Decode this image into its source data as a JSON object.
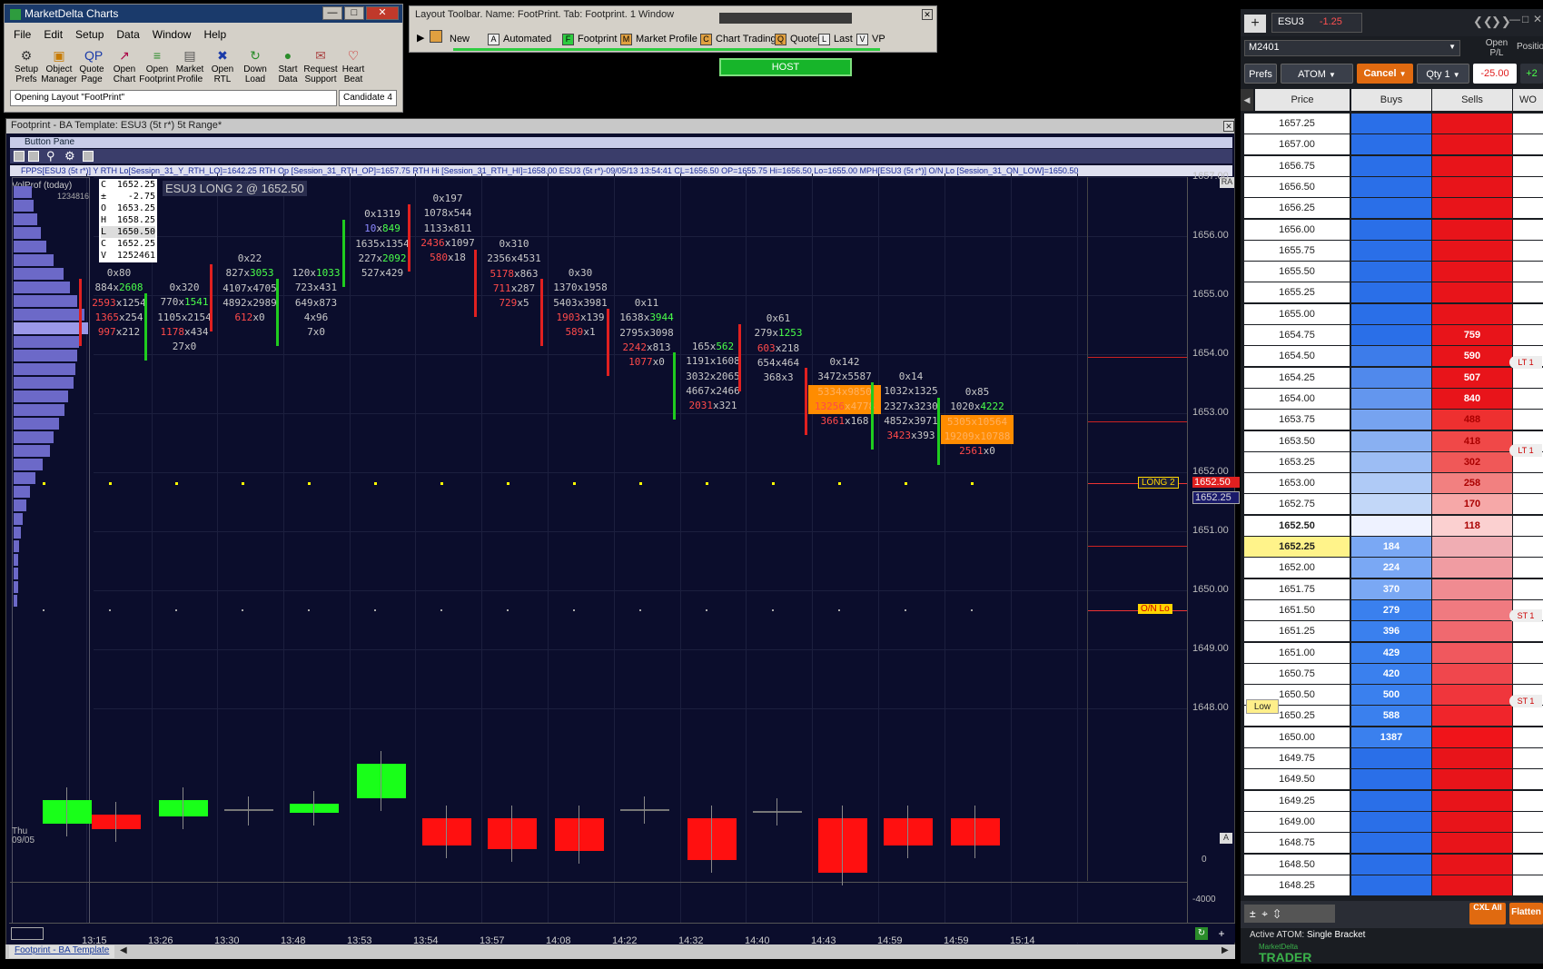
{
  "launcher": {
    "title": "MarketDelta Charts",
    "menu": [
      "File",
      "Edit",
      "Setup",
      "Data",
      "Window",
      "Help"
    ],
    "tools": [
      {
        "l1": "Setup",
        "l2": "Prefs",
        "icon": "gear-icon"
      },
      {
        "l1": "Object",
        "l2": "Manager",
        "icon": "object-manager-icon"
      },
      {
        "l1": "Quote",
        "l2": "Page",
        "icon": "quote-page-icon"
      },
      {
        "l1": "Open",
        "l2": "Chart",
        "icon": "chart-icon"
      },
      {
        "l1": "Open",
        "l2": "Footprint",
        "icon": "footprint-icon"
      },
      {
        "l1": "Market",
        "l2": "Profile",
        "icon": "market-profile-icon"
      },
      {
        "l1": "Open",
        "l2": "RTL",
        "icon": "rtl-icon"
      },
      {
        "l1": "Down",
        "l2": "Load",
        "icon": "download-icon"
      },
      {
        "l1": "Start",
        "l2": "Data",
        "icon": "start-data-icon"
      },
      {
        "l1": "Request",
        "l2": "Support",
        "icon": "support-icon"
      },
      {
        "l1": "Heart",
        "l2": "Beat",
        "icon": "heartbeat-icon"
      }
    ],
    "status": "Opening Layout \"FootPrint\"",
    "candidate": "Candidate 4"
  },
  "layout_toolbar": {
    "title": "Layout Toolbar.  Name: FootPrint.  Tab: Footprint.  1 Window",
    "items": [
      {
        "key": "",
        "label": "New"
      },
      {
        "key": "A",
        "label": "Automated"
      },
      {
        "key": "F",
        "label": "Footprint"
      },
      {
        "key": "M",
        "label": "Market Profile"
      },
      {
        "key": "C",
        "label": "Chart Trading"
      },
      {
        "key": "Q",
        "label": "Quotes"
      },
      {
        "key": "L",
        "label": "Last"
      },
      {
        "key": "V",
        "label": "VP"
      }
    ],
    "host": "HOST"
  },
  "chart": {
    "title": "Footprint - BA Template: ESU3 (5t r*) 5t Range*",
    "button_pane": "Button Pane",
    "study_line": "FPPS[ESU3 (5t r*)]  Y RTH Lo[Session_31_Y_RTH_LO]=1642.25  RTH Op [Session_31_RTH_OP]=1657.75  RTH Hi [Session_31_RTH_HI]=1658.00  ESU3 (5t r*)-09/05/13 13:54:41 CL=1656.50 OP=1655.75 Hi=1656.50 Lo=1655.00  MPH[ESU3 (5t r*)]  O/N Lo [Session_31_ON_LOW]=1650.50",
    "volprof": "VolProf (today)",
    "volprof_val": "1234816",
    "ra": "RA",
    "position": "ESU3 LONG 2 @ 1652.50",
    "ohlc": [
      [
        "C",
        "1652.25"
      ],
      [
        "±",
        "-2.75"
      ],
      [
        "O",
        "1653.25"
      ],
      [
        "H",
        "1658.25"
      ],
      [
        "L",
        "1650.50"
      ],
      [
        "C",
        "1652.25"
      ],
      [
        "V",
        "1252461"
      ]
    ],
    "price_axis": [
      "1657.00",
      "1656.00",
      "1655.00",
      "1654.00",
      "1653.00",
      "1652.00",
      "1651.00",
      "1650.00",
      "1649.00",
      "1648.00"
    ],
    "last_price": "1652.50",
    "bid_price": "1652.25",
    "long_tag": "LONG 2",
    "on_lo_tag": "O/N Lo",
    "lower_axis": [
      "0",
      "-4000"
    ],
    "time_labels": [
      "13:15",
      "13:26",
      "13:30",
      "13:48",
      "13:53",
      "13:54",
      "13:57",
      "14:08",
      "14:22",
      "14:32",
      "14:40",
      "14:43",
      "14:59",
      "14:59",
      "15:14"
    ],
    "day": "Thu",
    "date": "09/05",
    "tab": "Footprint - BA Template",
    "footprints": [
      [
        [
          "0x80",
          ""
        ],
        [
          "884",
          "2608"
        ],
        [
          "2593",
          "1254"
        ],
        [
          "1365",
          "254"
        ],
        [
          "997",
          "212"
        ]
      ],
      [
        [
          "0x320",
          ""
        ],
        [
          "770",
          "1541"
        ],
        [
          "1105",
          "2154"
        ],
        [
          "1178",
          "434"
        ],
        [
          "27",
          "0"
        ]
      ],
      [
        [
          "0x22",
          ""
        ],
        [
          "827",
          "3053"
        ],
        [
          "4107",
          "4705"
        ],
        [
          "4892",
          "2989"
        ],
        [
          "612",
          "0"
        ]
      ],
      [
        [
          "120",
          "1033"
        ],
        [
          "723",
          "431"
        ],
        [
          "649",
          "873"
        ],
        [
          "4",
          "96"
        ],
        [
          "7",
          "0"
        ]
      ],
      [
        [
          "0x1319",
          ""
        ],
        [
          "10",
          "849"
        ],
        [
          "1635",
          "1354"
        ],
        [
          "227",
          "2092"
        ],
        [
          "527",
          "429"
        ]
      ],
      [
        [
          "0x197",
          ""
        ],
        [
          "1078",
          "544"
        ],
        [
          "1133",
          "811"
        ],
        [
          "2436",
          "1097"
        ],
        [
          "580",
          "18"
        ]
      ],
      [
        [
          "0x310",
          ""
        ],
        [
          "2356",
          "4531"
        ],
        [
          "5178",
          "863"
        ],
        [
          "711",
          "287"
        ],
        [
          "729",
          "5"
        ]
      ],
      [
        [
          "0x30",
          ""
        ],
        [
          "1370",
          "1958"
        ],
        [
          "5403",
          "3981"
        ],
        [
          "1903",
          "139"
        ],
        [
          "589",
          "1"
        ]
      ],
      [
        [
          "0x11",
          ""
        ],
        [
          "1638",
          "3944"
        ],
        [
          "2795",
          "3098"
        ],
        [
          "2242",
          "813"
        ],
        [
          "1077",
          "0"
        ]
      ],
      [
        [
          "165",
          "562"
        ],
        [
          "1191",
          "1608"
        ],
        [
          "3032",
          "2065"
        ],
        [
          "4667",
          "2466"
        ],
        [
          "2031",
          "321"
        ]
      ],
      [
        [
          "0x61",
          ""
        ],
        [
          "279",
          "1253"
        ],
        [
          "603",
          "218"
        ],
        [
          "654",
          "464"
        ],
        [
          "368",
          "3"
        ]
      ],
      [
        [
          "0x142",
          ""
        ],
        [
          "3472",
          "5587"
        ],
        [
          "5334",
          "9850"
        ],
        [
          "13256",
          "4778"
        ],
        [
          "3661",
          "168"
        ]
      ],
      [
        [
          "0x14",
          ""
        ],
        [
          "1032",
          "1325"
        ],
        [
          "2327",
          "3230"
        ],
        [
          "4852",
          "3971"
        ],
        [
          "3423",
          "393"
        ]
      ],
      [
        [
          "0x85",
          ""
        ],
        [
          "1020",
          "4222"
        ],
        [
          "5305",
          "10564"
        ],
        [
          "19209",
          "10788"
        ],
        [
          "2561",
          "0"
        ]
      ]
    ]
  },
  "dom": {
    "symbol": "ESU3",
    "change": "-1.25",
    "account": "M2401",
    "open_pl_hdr": "Open P/L",
    "position_hdr": "Position",
    "prefs": "Prefs",
    "atom": "ATOM",
    "cancel": "Cancel",
    "qty": "Qty 1",
    "pl": "-25.00",
    "pos": "+2",
    "headers": {
      "price": "Price",
      "buys": "Buys",
      "sells": "Sells",
      "wo": "WO"
    },
    "rows": [
      {
        "p": "1657.25",
        "b": "",
        "s": ""
      },
      {
        "p": "1657.00",
        "b": "",
        "s": ""
      },
      {
        "p": "1656.75",
        "b": "",
        "s": ""
      },
      {
        "p": "1656.50",
        "b": "",
        "s": ""
      },
      {
        "p": "1656.25",
        "b": "",
        "s": ""
      },
      {
        "p": "1656.00",
        "b": "",
        "s": ""
      },
      {
        "p": "1655.75",
        "b": "",
        "s": ""
      },
      {
        "p": "1655.50",
        "b": "",
        "s": ""
      },
      {
        "p": "1655.25",
        "b": "",
        "s": ""
      },
      {
        "p": "1655.00",
        "b": "",
        "s": ""
      },
      {
        "p": "1654.75",
        "b": "",
        "s": "759"
      },
      {
        "p": "1654.50",
        "b": "",
        "s": "590"
      },
      {
        "p": "1654.25",
        "b": "",
        "s": "507"
      },
      {
        "p": "1654.00",
        "b": "",
        "s": "840"
      },
      {
        "p": "1653.75",
        "b": "",
        "s": "488"
      },
      {
        "p": "1653.50",
        "b": "",
        "s": "418"
      },
      {
        "p": "1653.25",
        "b": "",
        "s": "302"
      },
      {
        "p": "1653.00",
        "b": "",
        "s": "258"
      },
      {
        "p": "1652.75",
        "b": "",
        "s": "170"
      },
      {
        "p": "1652.50",
        "b": "",
        "s": "118"
      },
      {
        "p": "1652.25",
        "b": "184",
        "s": ""
      },
      {
        "p": "1652.00",
        "b": "224",
        "s": ""
      },
      {
        "p": "1651.75",
        "b": "370",
        "s": ""
      },
      {
        "p": "1651.50",
        "b": "279",
        "s": ""
      },
      {
        "p": "1651.25",
        "b": "396",
        "s": ""
      },
      {
        "p": "1651.00",
        "b": "429",
        "s": ""
      },
      {
        "p": "1650.75",
        "b": "420",
        "s": ""
      },
      {
        "p": "1650.50",
        "b": "500",
        "s": ""
      },
      {
        "p": "1650.25",
        "b": "588",
        "s": ""
      },
      {
        "p": "1650.00",
        "b": "1387",
        "s": ""
      },
      {
        "p": "1649.75",
        "b": "",
        "s": ""
      },
      {
        "p": "1649.50",
        "b": "",
        "s": ""
      },
      {
        "p": "1649.25",
        "b": "",
        "s": ""
      },
      {
        "p": "1649.00",
        "b": "",
        "s": ""
      },
      {
        "p": "1648.75",
        "b": "",
        "s": ""
      },
      {
        "p": "1648.50",
        "b": "",
        "s": ""
      },
      {
        "p": "1648.25",
        "b": "",
        "s": ""
      }
    ],
    "tags": {
      "lt1": "LT 1",
      "lt2": "LT 1",
      "st1": "ST 1",
      "st2": "ST 1",
      "low": "Low"
    },
    "cxl_all": "CXL All",
    "flatten": "Flatten",
    "active_atom_label": "Active ATOM:",
    "active_atom": "Single Bracket",
    "brand1": "MarketDelta",
    "brand2": "TRADER"
  }
}
